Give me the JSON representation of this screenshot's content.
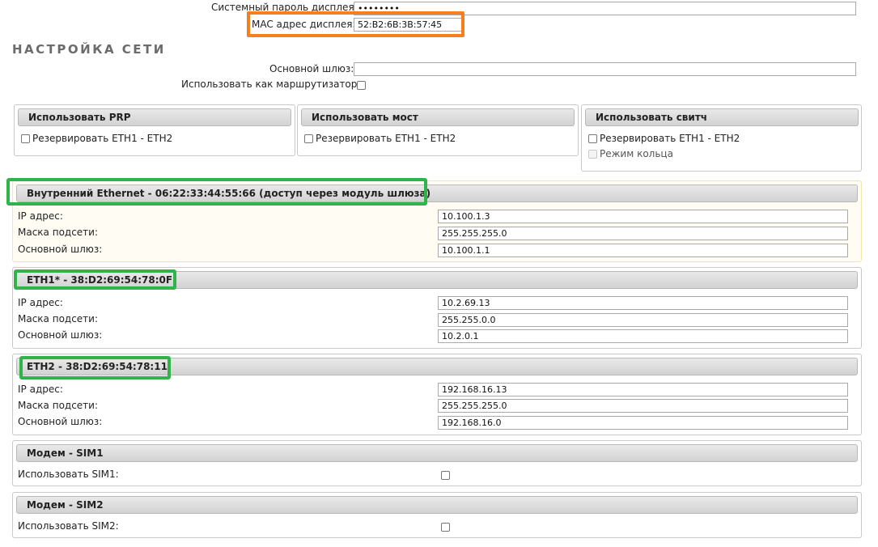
{
  "display": {
    "password_label": "Системный пароль дисплея:",
    "password_value": "••••••••",
    "mac_label": "MAC адрес дисплея:",
    "mac_value": "52:B2:6B:3B:57:45"
  },
  "network": {
    "title": "НАСТРОЙКА СЕТИ",
    "gateway_label": "Основной шлюз:",
    "gateway_value": "",
    "router_label": "Использовать как маршрутизатор:"
  },
  "modes": [
    {
      "title": "Использовать PRP",
      "options": [
        "Резервировать ETH1 - ETH2"
      ]
    },
    {
      "title": "Использовать мост",
      "options": [
        "Резервировать ETH1 - ETH2"
      ]
    },
    {
      "title": "Использовать свитч",
      "options": [
        "Резервировать ETH1 - ETH2",
        "Режим кольца"
      ]
    }
  ],
  "interfaces": [
    {
      "title": "Внутренний Ethernet - 06:22:33:44:55:66 (доступ через модуль шлюза)",
      "ip_label": "IP адрес:",
      "ip": "10.100.1.3",
      "mask_label": "Маска подсети:",
      "mask": "255.255.255.0",
      "gw_label": "Основной шлюз:",
      "gw": "10.100.1.1"
    },
    {
      "title": "ETH1* - 38:D2:69:54:78:0F",
      "ip_label": "IP адрес:",
      "ip": "10.2.69.13",
      "mask_label": "Маска подсети:",
      "mask": "255.255.0.0",
      "gw_label": "Основной шлюз:",
      "gw": "10.2.0.1"
    },
    {
      "title": "ETH2 - 38:D2:69:54:78:11",
      "ip_label": "IP адрес:",
      "ip": "192.168.16.13",
      "mask_label": "Маска подсети:",
      "mask": "255.255.255.0",
      "gw_label": "Основной шлюз:",
      "gw": "192.168.16.0"
    }
  ],
  "modems": [
    {
      "title": "Модем - SIM1",
      "label": "Использовать SIM1:"
    },
    {
      "title": "Модем - SIM2",
      "label": "Использовать SIM2:"
    }
  ],
  "colors": {
    "highlight_orange": "#f47f20",
    "highlight_green": "#2fb34a"
  }
}
